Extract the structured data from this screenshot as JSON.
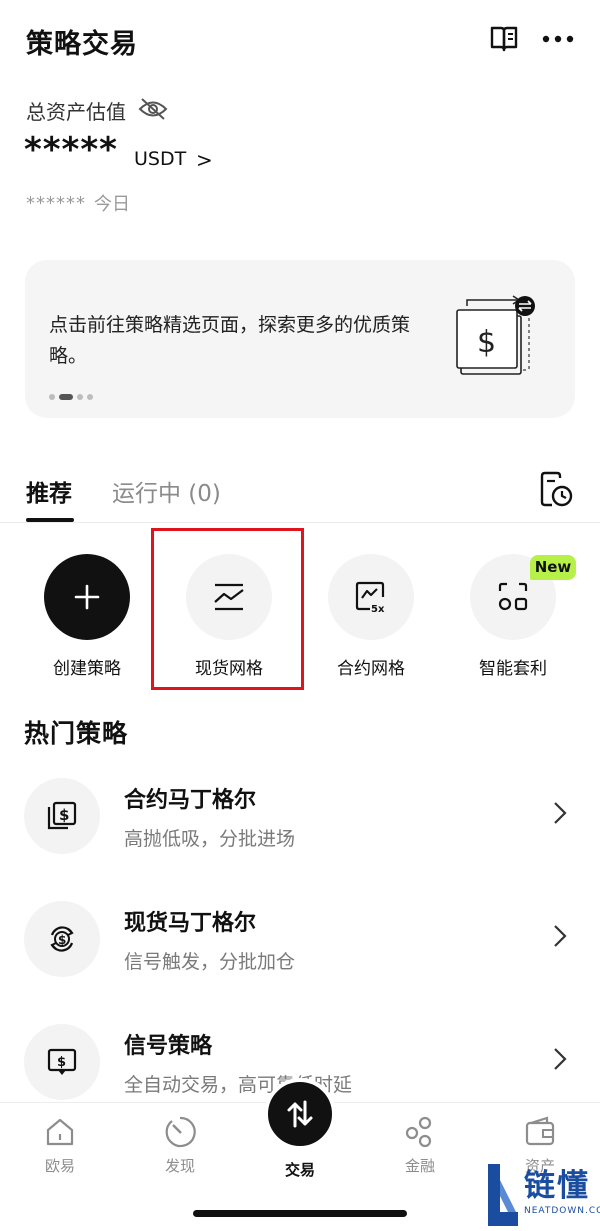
{
  "header": {
    "title": "策略交易",
    "book_icon": "book-icon",
    "more_icon": "more-icon"
  },
  "assets": {
    "label": "总资产估值",
    "value": "*****",
    "unit": "USDT",
    "chevron": ">",
    "today_value": "******",
    "today_label": "今日"
  },
  "banner": {
    "text": "点击前往策略精选页面，探索更多的优质策略。",
    "page_count": 4,
    "active_page": 2
  },
  "tabs": [
    {
      "label": "推荐",
      "active": true
    },
    {
      "label": "运行中 (0)",
      "active": false
    }
  ],
  "actions": [
    {
      "label": "创建策略",
      "icon": "plus-icon"
    },
    {
      "label": "现货网格",
      "icon": "grid-chart-icon"
    },
    {
      "label": "合约网格",
      "icon": "contract-grid-5x-icon"
    },
    {
      "label": "智能套利",
      "icon": "arbitrage-icon",
      "badge": "New"
    }
  ],
  "popular": {
    "title": "热门策略",
    "items": [
      {
        "title": "合约马丁格尔",
        "subtitle": "高抛低吸，分批进场",
        "icon": "dollar-cards-icon"
      },
      {
        "title": "现货马丁格尔",
        "subtitle": "信号触发，分批加仓",
        "icon": "dollar-cycle-icon"
      },
      {
        "title": "信号策略",
        "subtitle": "全自动交易，高可靠低时延",
        "icon": "signal-screen-icon"
      }
    ]
  },
  "bottom_nav": [
    {
      "label": "欧易",
      "icon": "home-icon",
      "active": false
    },
    {
      "label": "发现",
      "icon": "discover-icon",
      "active": false
    },
    {
      "label": "交易",
      "icon": "trade-icon",
      "active": true
    },
    {
      "label": "金融",
      "icon": "finance-icon",
      "active": false
    },
    {
      "label": "资产",
      "icon": "wallet-icon",
      "active": false
    }
  ],
  "watermark": {
    "text": "链懂",
    "sub": "NEATDOWN.COM"
  },
  "colors": {
    "highlight": "#e0141c",
    "new_badge": "#b8f04a",
    "watermark": "#1a4da0"
  }
}
